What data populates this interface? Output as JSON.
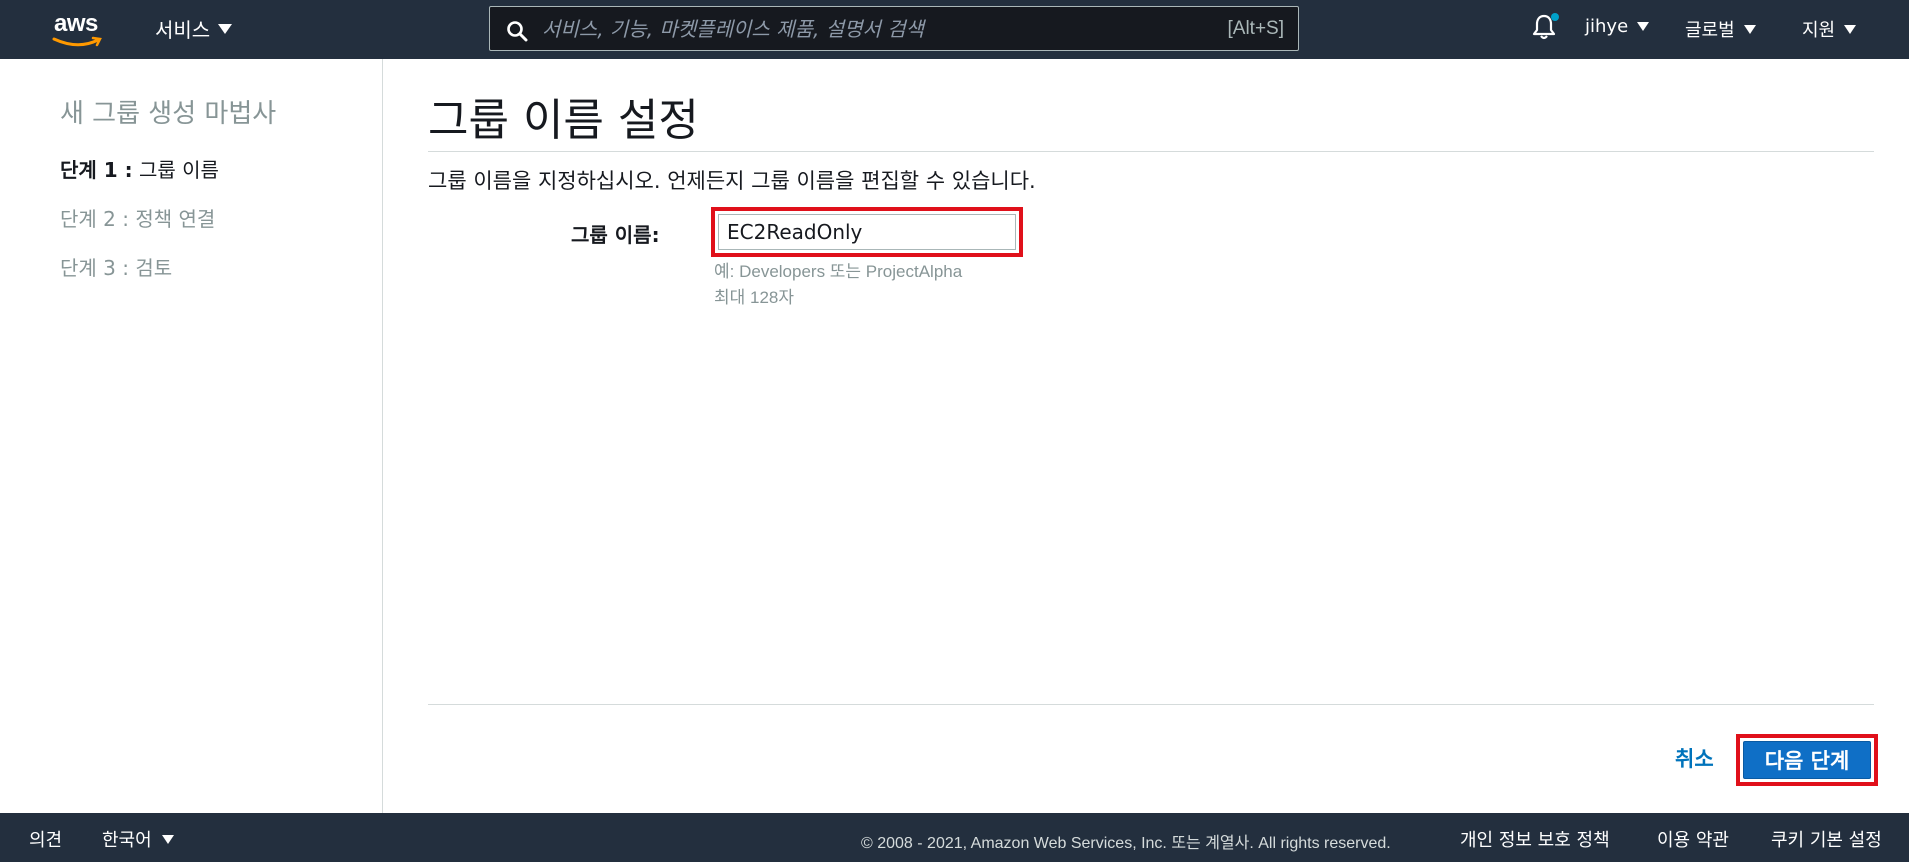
{
  "header": {
    "logo_text": "aws",
    "services_label": "서비스",
    "search": {
      "placeholder": "서비스, 기능, 마켓플레이스 제품, 설명서 검색",
      "shortcut": "[Alt+S]"
    },
    "user_label": "jihye",
    "region_label": "글로벌",
    "support_label": "지원"
  },
  "sidebar": {
    "title": "새 그룹 생성 마법사",
    "steps": [
      {
        "prefix": "단계 1 :",
        "label": "그룹 이름"
      },
      {
        "prefix": "단계 2 :",
        "label": "정책 연결"
      },
      {
        "prefix": "단계 3 :",
        "label": "검토"
      }
    ]
  },
  "main": {
    "title": "그룹 이름 설정",
    "description": "그룹 이름을 지정하십시오. 언제든지 그룹 이름을 편집할 수 있습니다.",
    "group_name_label": "그룹 이름:",
    "group_name_value": "EC2ReadOnly",
    "hint_example": "예: Developers 또는 ProjectAlpha",
    "hint_max": "최대 128자",
    "cancel_label": "취소",
    "next_label": "다음 단계"
  },
  "footer": {
    "feedback": "의견",
    "language": "한국어",
    "copyright": "© 2008 - 2021, Amazon Web Services, Inc. 또는 계열사. All rights reserved.",
    "privacy": "개인 정보 보호 정책",
    "terms": "이용 약관",
    "cookies": "쿠키 기본 설정"
  },
  "colors": {
    "header_bg": "#232f3e",
    "accent_link": "#0073bb",
    "primary_button": "#0f6fc6",
    "highlight_border": "#e0101a"
  }
}
